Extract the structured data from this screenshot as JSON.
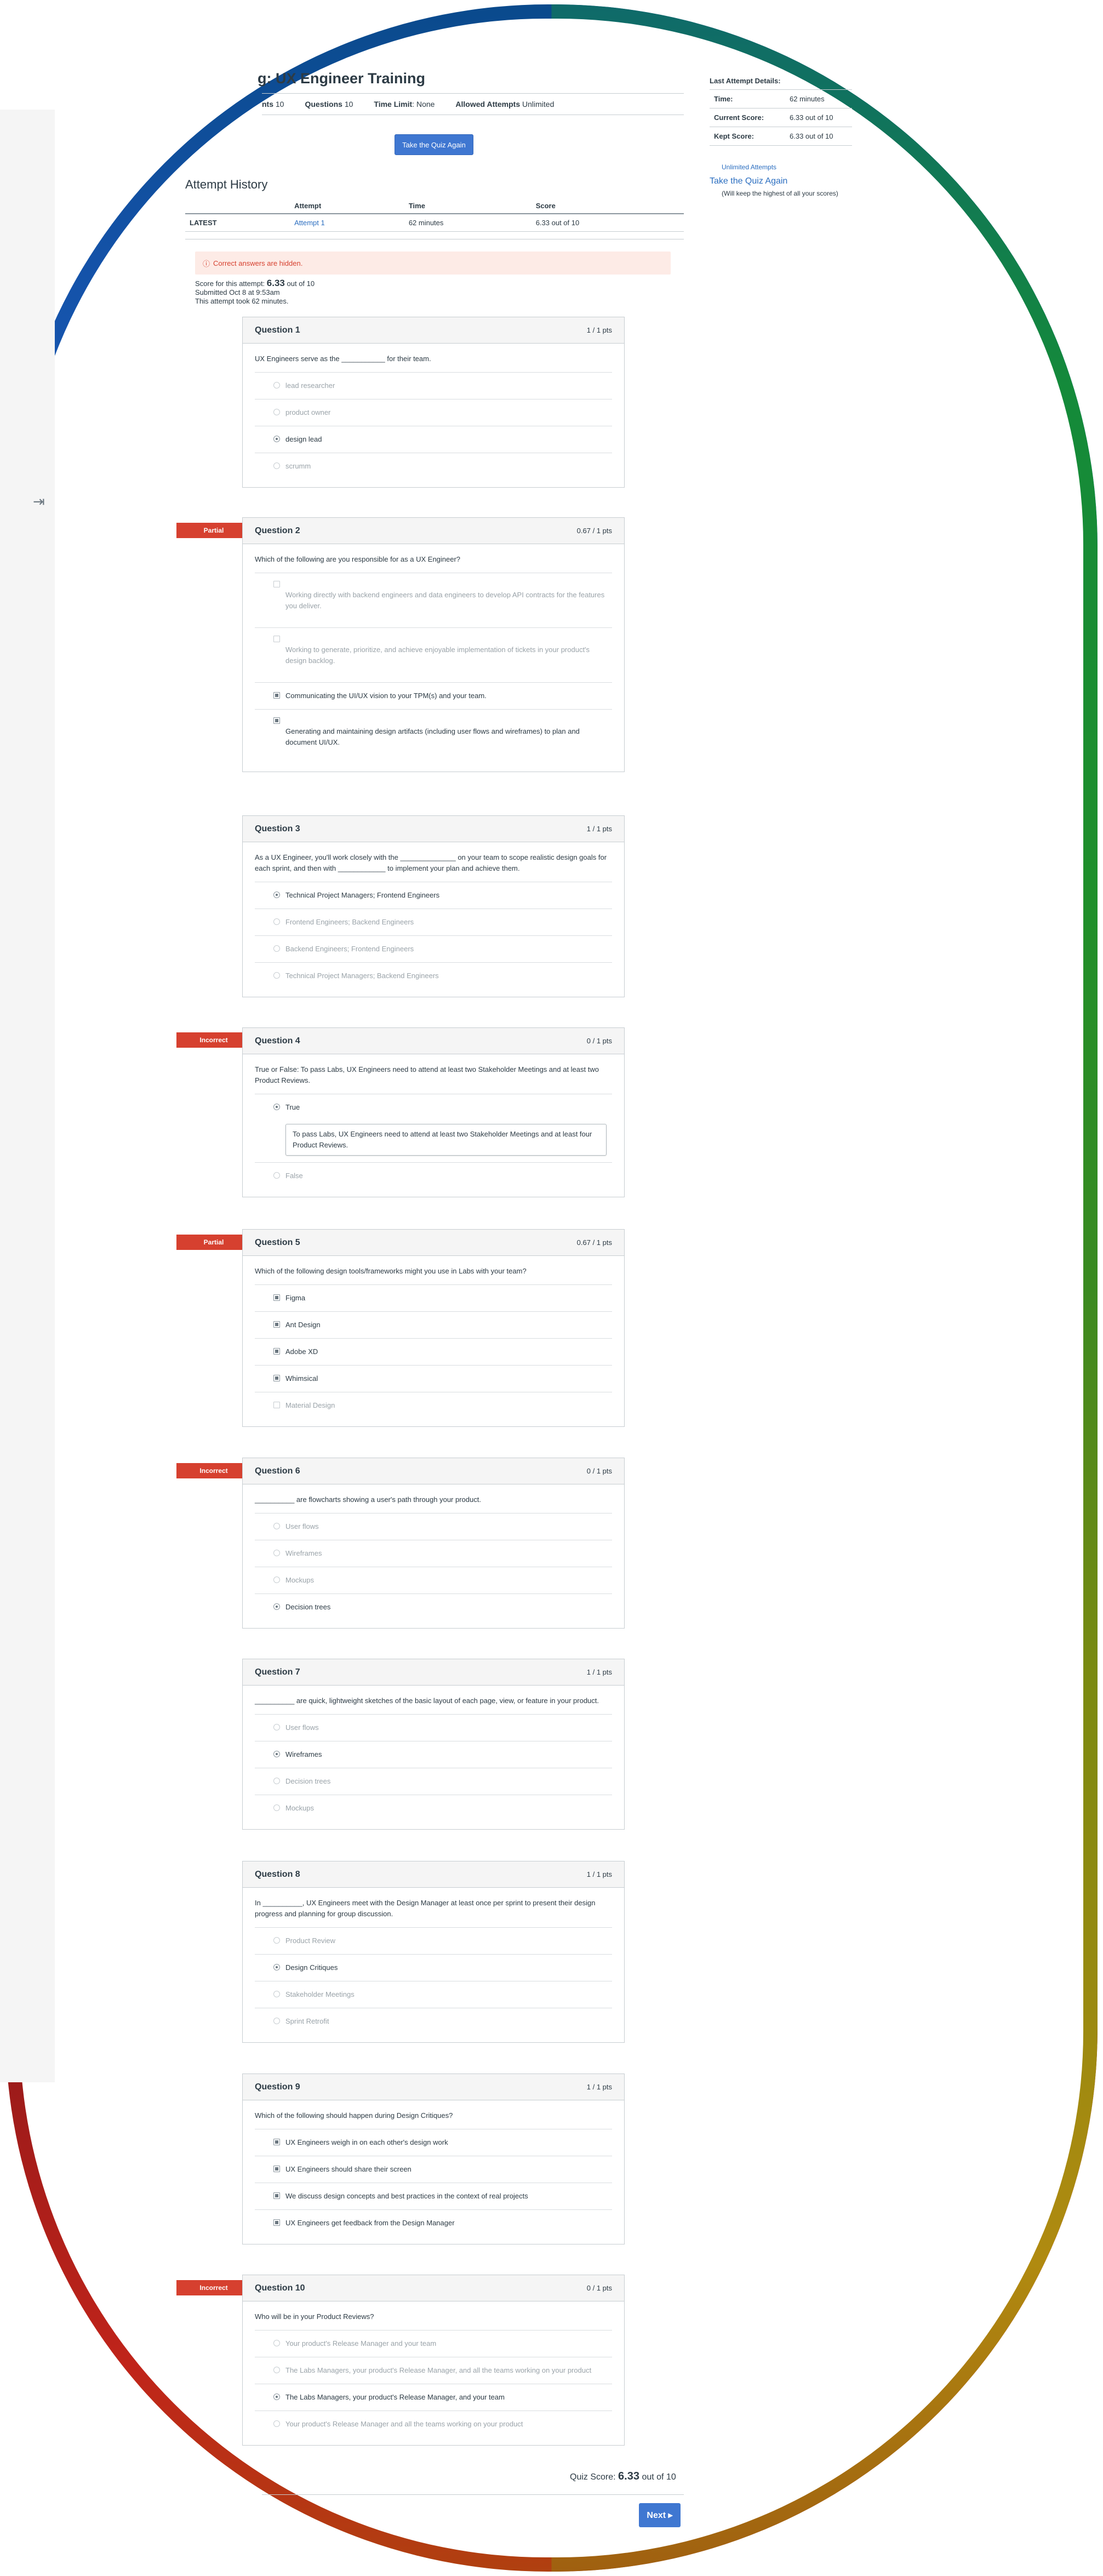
{
  "header": {
    "quiz_title": "g: UX Engineer Training",
    "points_label": "nts",
    "points_value": "10",
    "questions_label": "Questions",
    "questions_value": "10",
    "time_limit_label": "Time Limit",
    "time_limit_value": "None",
    "allowed_attempts_label": "Allowed Attempts",
    "allowed_attempts_value": "Unlimited",
    "take_again_button": "Take the Quiz Again"
  },
  "history": {
    "title": "Attempt History",
    "columns": [
      "",
      "Attempt",
      "Time",
      "Score"
    ],
    "rows": [
      {
        "label": "LATEST",
        "attempt": "Attempt 1",
        "time": "62 minutes",
        "score": "6.33 out of 10"
      }
    ]
  },
  "result": {
    "hidden_notice": "Correct answers are hidden.",
    "score_prefix": "Score for this attempt:",
    "score_value": "6.33",
    "score_suffix": "out of 10",
    "submitted": "Submitted Oct 8 at 9:53am",
    "duration": "This attempt took 62 minutes."
  },
  "sidebar": {
    "title": "Last Attempt Details:",
    "rows": [
      {
        "k": "Time:",
        "v": "62 minutes"
      },
      {
        "k": "Current Score:",
        "v": "6.33 out of 10"
      },
      {
        "k": "Kept Score:",
        "v": "6.33 out of 10"
      }
    ],
    "unlimited": "Unlimited Attempts",
    "take_again_link": "Take the Quiz Again",
    "keep_note": "(Will keep the highest of all your scores)"
  },
  "questions": [
    {
      "name": "Question 1",
      "pts": "1 / 1 pts",
      "text": "UX Engineers serve as the ___________ for their team.",
      "answers": [
        "lead researcher",
        "product owner",
        "design lead",
        "scrumm"
      ]
    },
    {
      "name": "Question 2",
      "pts": "0.67 / 1 pts",
      "flag": "Partial",
      "text": "Which of the following are you responsible for as a UX Engineer?",
      "answers": [
        "Working directly with backend engineers and data engineers to develop API contracts for the features you deliver.",
        "Working to generate, prioritize, and achieve enjoyable implementation of tickets in your product's design backlog.",
        "Communicating the UI/UX vision to your TPM(s) and your team.",
        "Generating and maintaining design artifacts (including user flows and wireframes) to plan and document UI/UX."
      ]
    },
    {
      "name": "Question 3",
      "pts": "1 / 1 pts",
      "text": "As a UX Engineer, you'll work closely with the ______________ on your team to scope realistic design goals for each sprint, and then with ____________ to implement your plan and achieve them.",
      "answers": [
        "Technical Project Managers; Frontend Engineers",
        "Frontend Engineers; Backend Engineers",
        "Backend Engineers; Frontend Engineers",
        "Technical Project Managers; Backend Engineers"
      ]
    },
    {
      "name": "Question 4",
      "pts": "0 / 1 pts",
      "flag": "Incorrect",
      "text": "True or False: To pass Labs, UX Engineers need to attend at least two Stakeholder Meetings and at least two Product Reviews.",
      "answers": [
        "True",
        "False"
      ],
      "comment": "To pass Labs, UX Engineers need to attend at least two Stakeholder Meetings and at least four Product Reviews."
    },
    {
      "name": "Question 5",
      "pts": "0.67 / 1 pts",
      "flag": "Partial",
      "text": "Which of the following design tools/frameworks might you use in Labs with your team?",
      "answers": [
        "Figma",
        "Ant Design",
        "Adobe XD",
        "Whimsical",
        "Material Design"
      ]
    },
    {
      "name": "Question 6",
      "pts": "0 / 1 pts",
      "flag": "Incorrect",
      "text": "__________ are flowcharts showing a user's path through your product.",
      "answers": [
        "User flows",
        "Wireframes",
        "Mockups",
        "Decision trees"
      ]
    },
    {
      "name": "Question 7",
      "pts": "1 / 1 pts",
      "text": "__________ are quick, lightweight sketches of the basic layout of each page, view, or feature in your product.",
      "answers": [
        "User flows",
        "Wireframes",
        "Decision trees",
        "Mockups"
      ]
    },
    {
      "name": "Question 8",
      "pts": "1 / 1 pts",
      "text": "In __________, UX Engineers meet with the Design Manager at least once per sprint to present their design progress and planning for group discussion.",
      "answers": [
        "Product Review",
        "Design Critiques",
        "Stakeholder Meetings",
        "Sprint Retrofit"
      ]
    },
    {
      "name": "Question 9",
      "pts": "1 / 1 pts",
      "text": "Which of the following should happen during Design Critiques?",
      "answers": [
        "UX Engineers weigh in on each other's design work",
        "UX Engineers should share their screen",
        "We discuss design concepts and best practices in the context of real projects",
        "UX Engineers get feedback from the Design Manager"
      ]
    },
    {
      "name": "Question 10",
      "pts": "0 / 1 pts",
      "flag": "Incorrect",
      "text": "Who will be in your Product Reviews?",
      "answers": [
        "Your product's Release Manager and your team",
        "The Labs Managers, your product's Release Manager, and all the teams working on your product",
        "The Labs Managers, your product's Release Manager, and your team",
        "Your product's Release Manager and all the teams working on your product"
      ]
    }
  ],
  "footer": {
    "quiz_score_label": "Quiz Score:",
    "quiz_score_value": "6.33",
    "quiz_score_suffix": "out of 10",
    "next_button": "Next ▸"
  }
}
